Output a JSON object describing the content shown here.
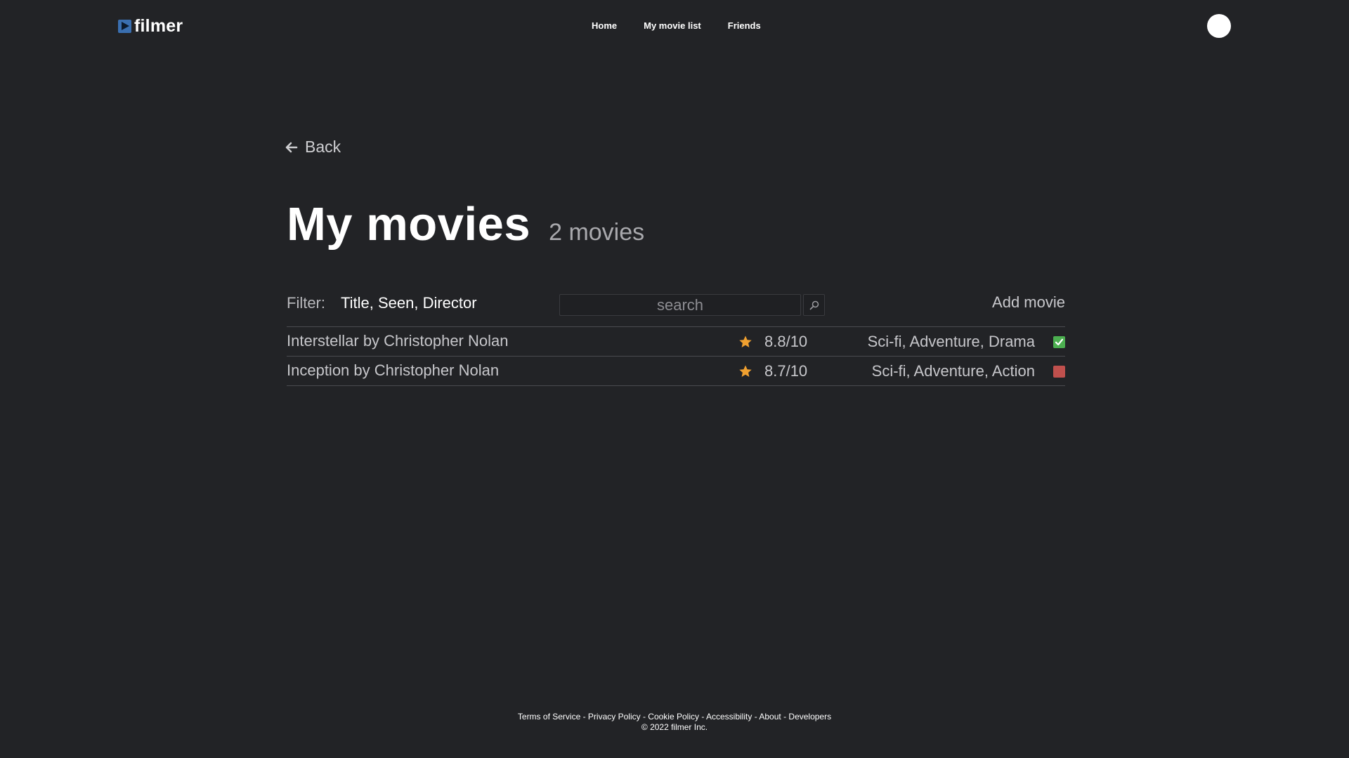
{
  "brand": {
    "name": "filmer",
    "logo_icon": "play-logo-icon",
    "logo_color": "#3a6fb0"
  },
  "nav": {
    "items": [
      {
        "label": "Home"
      },
      {
        "label": "My movie list"
      },
      {
        "label": "Friends"
      }
    ]
  },
  "user": {
    "avatar_icon": "avatar"
  },
  "page": {
    "back_label": "Back",
    "title": "My movies",
    "count_text": "2 movies"
  },
  "filter": {
    "label": "Filter:",
    "options": "Title, Seen, Director",
    "search_placeholder": "search",
    "search_value": "",
    "search_icon": "search-icon",
    "add_movie_label": "Add movie"
  },
  "movies": [
    {
      "title": "Interstellar by Christopher Nolan",
      "rating": "8.8/10",
      "genres": "Sci-fi, Adventure, Drama",
      "seen": true
    },
    {
      "title": "Inception by Christopher Nolan",
      "rating": "8.7/10",
      "genres": "Sci-fi, Adventure, Action",
      "seen": false
    }
  ],
  "colors": {
    "background": "#222326",
    "star": "#f0a030",
    "seen_true": "#4caf50",
    "seen_false": "#c0504d"
  },
  "footer": {
    "links": [
      "Terms of Service",
      "Privacy Policy",
      "Cookie Policy",
      "Accessibility",
      "About",
      "Developers"
    ],
    "separator": " - ",
    "copyright": "© 2022 filmer Inc."
  }
}
